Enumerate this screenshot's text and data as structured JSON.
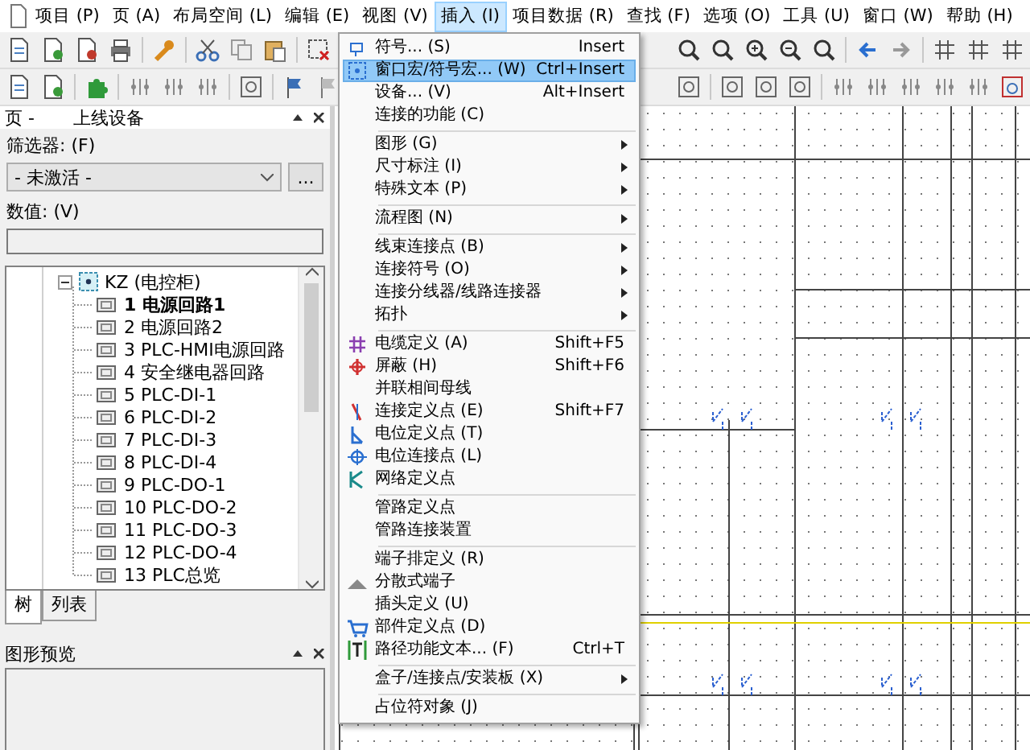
{
  "menubar": [
    {
      "label": "项目 (P)",
      "selected": false
    },
    {
      "label": "页 (A)",
      "selected": false
    },
    {
      "label": "布局空间 (L)",
      "selected": false
    },
    {
      "label": "编辑 (E)",
      "selected": false
    },
    {
      "label": "视图 (V)",
      "selected": false
    },
    {
      "label": "插入 (I)",
      "selected": true
    },
    {
      "label": "项目数据 (R)",
      "selected": false
    },
    {
      "label": "查找 (F)",
      "selected": false
    },
    {
      "label": "选项 (O)",
      "selected": false
    },
    {
      "label": "工具 (U)",
      "selected": false
    },
    {
      "label": "窗口 (W)",
      "selected": false
    },
    {
      "label": "帮助 (H)",
      "selected": false
    }
  ],
  "page_panel": {
    "title": "页 -",
    "subtitle": "上线设备",
    "filter_label": "筛选器: (F)",
    "filter_value": "- 未激活 -",
    "filter_button": "...",
    "value_label": "数值: (V)",
    "tree": [
      {
        "label": "KZ (电控柜)",
        "expanded": true,
        "children": [
          {
            "label": "1 电源回路1",
            "active": true
          },
          {
            "label": "2 电源回路2",
            "active": false
          },
          {
            "label": "3 PLC-HMI电源回路",
            "active": false
          },
          {
            "label": "4 安全继电器回路",
            "active": false
          },
          {
            "label": "5 PLC-DI-1",
            "active": false
          },
          {
            "label": "6 PLC-DI-2",
            "active": false
          },
          {
            "label": "7 PLC-DI-3",
            "active": false
          },
          {
            "label": "8 PLC-DI-4",
            "active": false
          },
          {
            "label": "9 PLC-DO-1",
            "active": false
          },
          {
            "label": "10 PLC-DO-2",
            "active": false
          },
          {
            "label": "11 PLC-DO-3",
            "active": false
          },
          {
            "label": "12 PLC-DO-4",
            "active": false
          },
          {
            "label": "13 PLC总览",
            "active": false
          }
        ]
      }
    ],
    "tabs": [
      {
        "label": "树",
        "selected": true
      },
      {
        "label": "列表",
        "selected": false
      }
    ]
  },
  "preview_panel": {
    "title": "图形预览"
  },
  "insert_menu": {
    "groups": [
      [
        {
          "label": "符号... (S)",
          "shortcut": "Insert",
          "submenu": false,
          "selected": false
        },
        {
          "label": "窗口宏/符号宏... (W)",
          "shortcut": "Ctrl+Insert",
          "submenu": false,
          "selected": true
        },
        {
          "label": "设备... (V)",
          "shortcut": "Alt+Insert",
          "submenu": false,
          "selected": false
        },
        {
          "label": "连接的功能 (C)",
          "submenu": false,
          "selected": false
        }
      ],
      [
        {
          "label": "图形 (G)",
          "submenu": true,
          "selected": false
        },
        {
          "label": "尺寸标注 (I)",
          "submenu": true,
          "selected": false
        },
        {
          "label": "特殊文本 (P)",
          "submenu": true,
          "selected": false
        }
      ],
      [
        {
          "label": "流程图 (N)",
          "submenu": true,
          "selected": false
        }
      ],
      [
        {
          "label": "线束连接点 (B)",
          "submenu": true,
          "selected": false
        },
        {
          "label": "连接符号 (O)",
          "submenu": true,
          "selected": false
        },
        {
          "label": "连接分线器/线路连接器",
          "submenu": true,
          "selected": false
        },
        {
          "label": "拓扑",
          "submenu": true,
          "selected": false
        }
      ],
      [
        {
          "label": "电缆定义 (A)",
          "shortcut": "Shift+F5",
          "submenu": false,
          "selected": false
        },
        {
          "label": "屏蔽 (H)",
          "shortcut": "Shift+F6",
          "submenu": false,
          "selected": false
        },
        {
          "label": "并联相间母线",
          "submenu": false,
          "selected": false
        },
        {
          "label": "连接定义点 (E)",
          "shortcut": "Shift+F7",
          "submenu": false,
          "selected": false
        },
        {
          "label": "电位定义点 (T)",
          "submenu": false,
          "selected": false
        },
        {
          "label": "电位连接点 (L)",
          "submenu": false,
          "selected": false
        },
        {
          "label": "网络定义点",
          "submenu": false,
          "selected": false
        }
      ],
      [
        {
          "label": "管路定义点",
          "submenu": false,
          "selected": false
        },
        {
          "label": "管路连接装置",
          "submenu": false,
          "selected": false
        }
      ],
      [
        {
          "label": "端子排定义 (R)",
          "submenu": false,
          "selected": false
        },
        {
          "label": "分散式端子",
          "submenu": false,
          "selected": false
        },
        {
          "label": "插头定义 (U)",
          "submenu": false,
          "selected": false
        },
        {
          "label": "部件定义点 (D)",
          "submenu": false,
          "selected": false
        },
        {
          "label": "路径功能文本... (F)",
          "shortcut": "Ctrl+T",
          "submenu": false,
          "selected": false
        }
      ],
      [
        {
          "label": "盒子/连接点/安装板 (X)",
          "submenu": true,
          "selected": false
        }
      ],
      [
        {
          "label": "占位符对象 (J)",
          "submenu": false,
          "selected": false
        }
      ]
    ]
  }
}
